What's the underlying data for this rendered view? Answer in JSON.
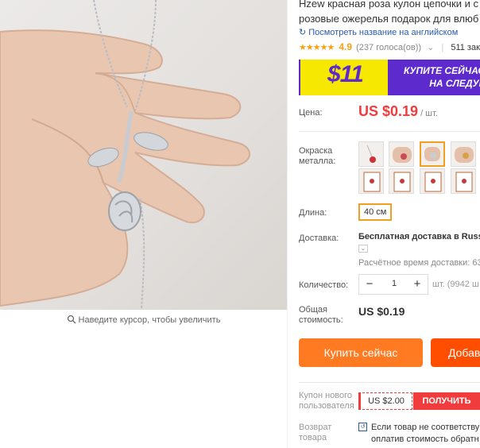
{
  "product": {
    "title_line1": "Hzew красная роза кулон цепочки и с",
    "title_line2": "розовые ожерелья подарок для влюб",
    "translate_link": "Посмотреть название на английском",
    "rating": "4.9",
    "votes": "(237 голоса(ов))",
    "orders": "511 зак"
  },
  "banner": {
    "big_text": "$11",
    "line1": "КУПИТЕ СЕЙЧАС",
    "line2": "НА СЛЕДУК"
  },
  "price": {
    "label": "Цена:",
    "value": "US $0.19",
    "unit": "/ шт."
  },
  "color": {
    "label_line1": "Окраска",
    "label_line2": "металла:",
    "selected_index": 2
  },
  "length": {
    "label": "Длина:",
    "value": "40 см"
  },
  "shipping": {
    "label": "Доставка:",
    "method": "Бесплатная доставка в Russi",
    "time": "Расчётное время доставки: 63"
  },
  "quantity": {
    "label": "Количество:",
    "minus": "−",
    "value": "1",
    "plus": "+",
    "stock_note": "шт. (9942 ш"
  },
  "total": {
    "label_line1": "Общая",
    "label_line2": "стоимость:",
    "value": "US $0.19"
  },
  "buttons": {
    "buy_now": "Купить сейчас",
    "add_to_cart": "Добав"
  },
  "coupon": {
    "label_line1": "Купон нового",
    "label_line2": "пользователя",
    "amount": "US $2.00",
    "get": "ПОЛУЧИТЬ"
  },
  "returns": {
    "label_line1": "Возврат",
    "label_line2": "товара",
    "text_line1": "Если товар не соответству",
    "text_line2": "оплатив стоимость обратн"
  },
  "image": {
    "zoom_hint": "Наведите курсор, чтобы увеличить"
  },
  "colors": {
    "price_red": "#f03c3c",
    "buy_orange": "#ff7a21",
    "cart_orange": "#ff4e00",
    "star": "#f7a012",
    "link_blue": "#2a5aa8",
    "banner_purple": "#5d2bcd",
    "banner_yellow": "#f7e800",
    "selection_border": "#f0a020"
  }
}
